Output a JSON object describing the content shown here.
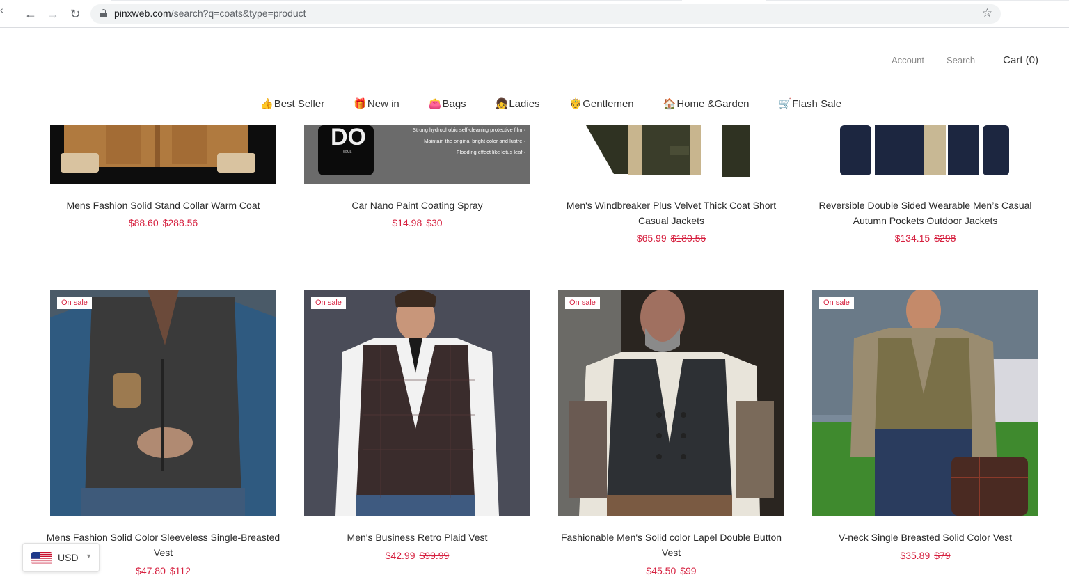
{
  "browser": {
    "url_host": "pinxweb.com",
    "url_path": "/search?q=coats&type=product",
    "back_icon": "arrow-left-icon",
    "forward_icon": "arrow-right-icon",
    "reload_icon": "reload-icon",
    "bookmark_icon": "star-icon"
  },
  "header": {
    "account": "Account",
    "search": "Search",
    "cart": "Cart (0)"
  },
  "nav": [
    {
      "emoji": "👍",
      "label": "Best Seller"
    },
    {
      "emoji": "🎁",
      "label": "New in"
    },
    {
      "emoji": "👛",
      "label": "Bags"
    },
    {
      "emoji": "👧",
      "label": "Ladies"
    },
    {
      "emoji": "🤴",
      "label": "Gentlemen"
    },
    {
      "emoji": "🏠",
      "label": "Home &Garden"
    },
    {
      "emoji": "🛒",
      "label": "Flash Sale"
    }
  ],
  "products_row1": [
    {
      "title": "Mens Fashion Solid Stand Collar Warm Coat",
      "price": "$88.60",
      "was": "$288.56"
    },
    {
      "title": "Car Nano Paint Coating Spray",
      "price": "$14.98",
      "was": "$30",
      "img_text": [
        "Strong hydrophobic self-cleaning protective film ·",
        "Maintain the original bright color and lustre ·",
        "Flooding effect like lotus leaf ·"
      ]
    },
    {
      "title": "Men's Windbreaker Plus Velvet Thick Coat Short Casual Jackets",
      "price": "$65.99",
      "was": "$180.55"
    },
    {
      "title": "Reversible Double Sided Wearable Men’s Casual Autumn Pockets Outdoor Jackets",
      "price": "$134.15",
      "was": "$298"
    }
  ],
  "products_row2": [
    {
      "badge": "On sale",
      "title": "Mens Fashion Solid Color Sleeveless Single-Breasted Vest",
      "price": "$47.80",
      "was": "$112"
    },
    {
      "badge": "On sale",
      "title": "Men's Business Retro Plaid Vest",
      "price": "$42.99",
      "was": "$99.99"
    },
    {
      "badge": "On sale",
      "title": "Fashionable Men's Solid color Lapel Double Button Vest",
      "price": "$45.50",
      "was": "$99"
    },
    {
      "badge": "On sale",
      "title": "V-neck Single Breasted Solid Color Vest",
      "price": "$35.89",
      "was": "$79"
    }
  ],
  "currency": {
    "code": "USD",
    "flag": "us-flag-icon"
  }
}
